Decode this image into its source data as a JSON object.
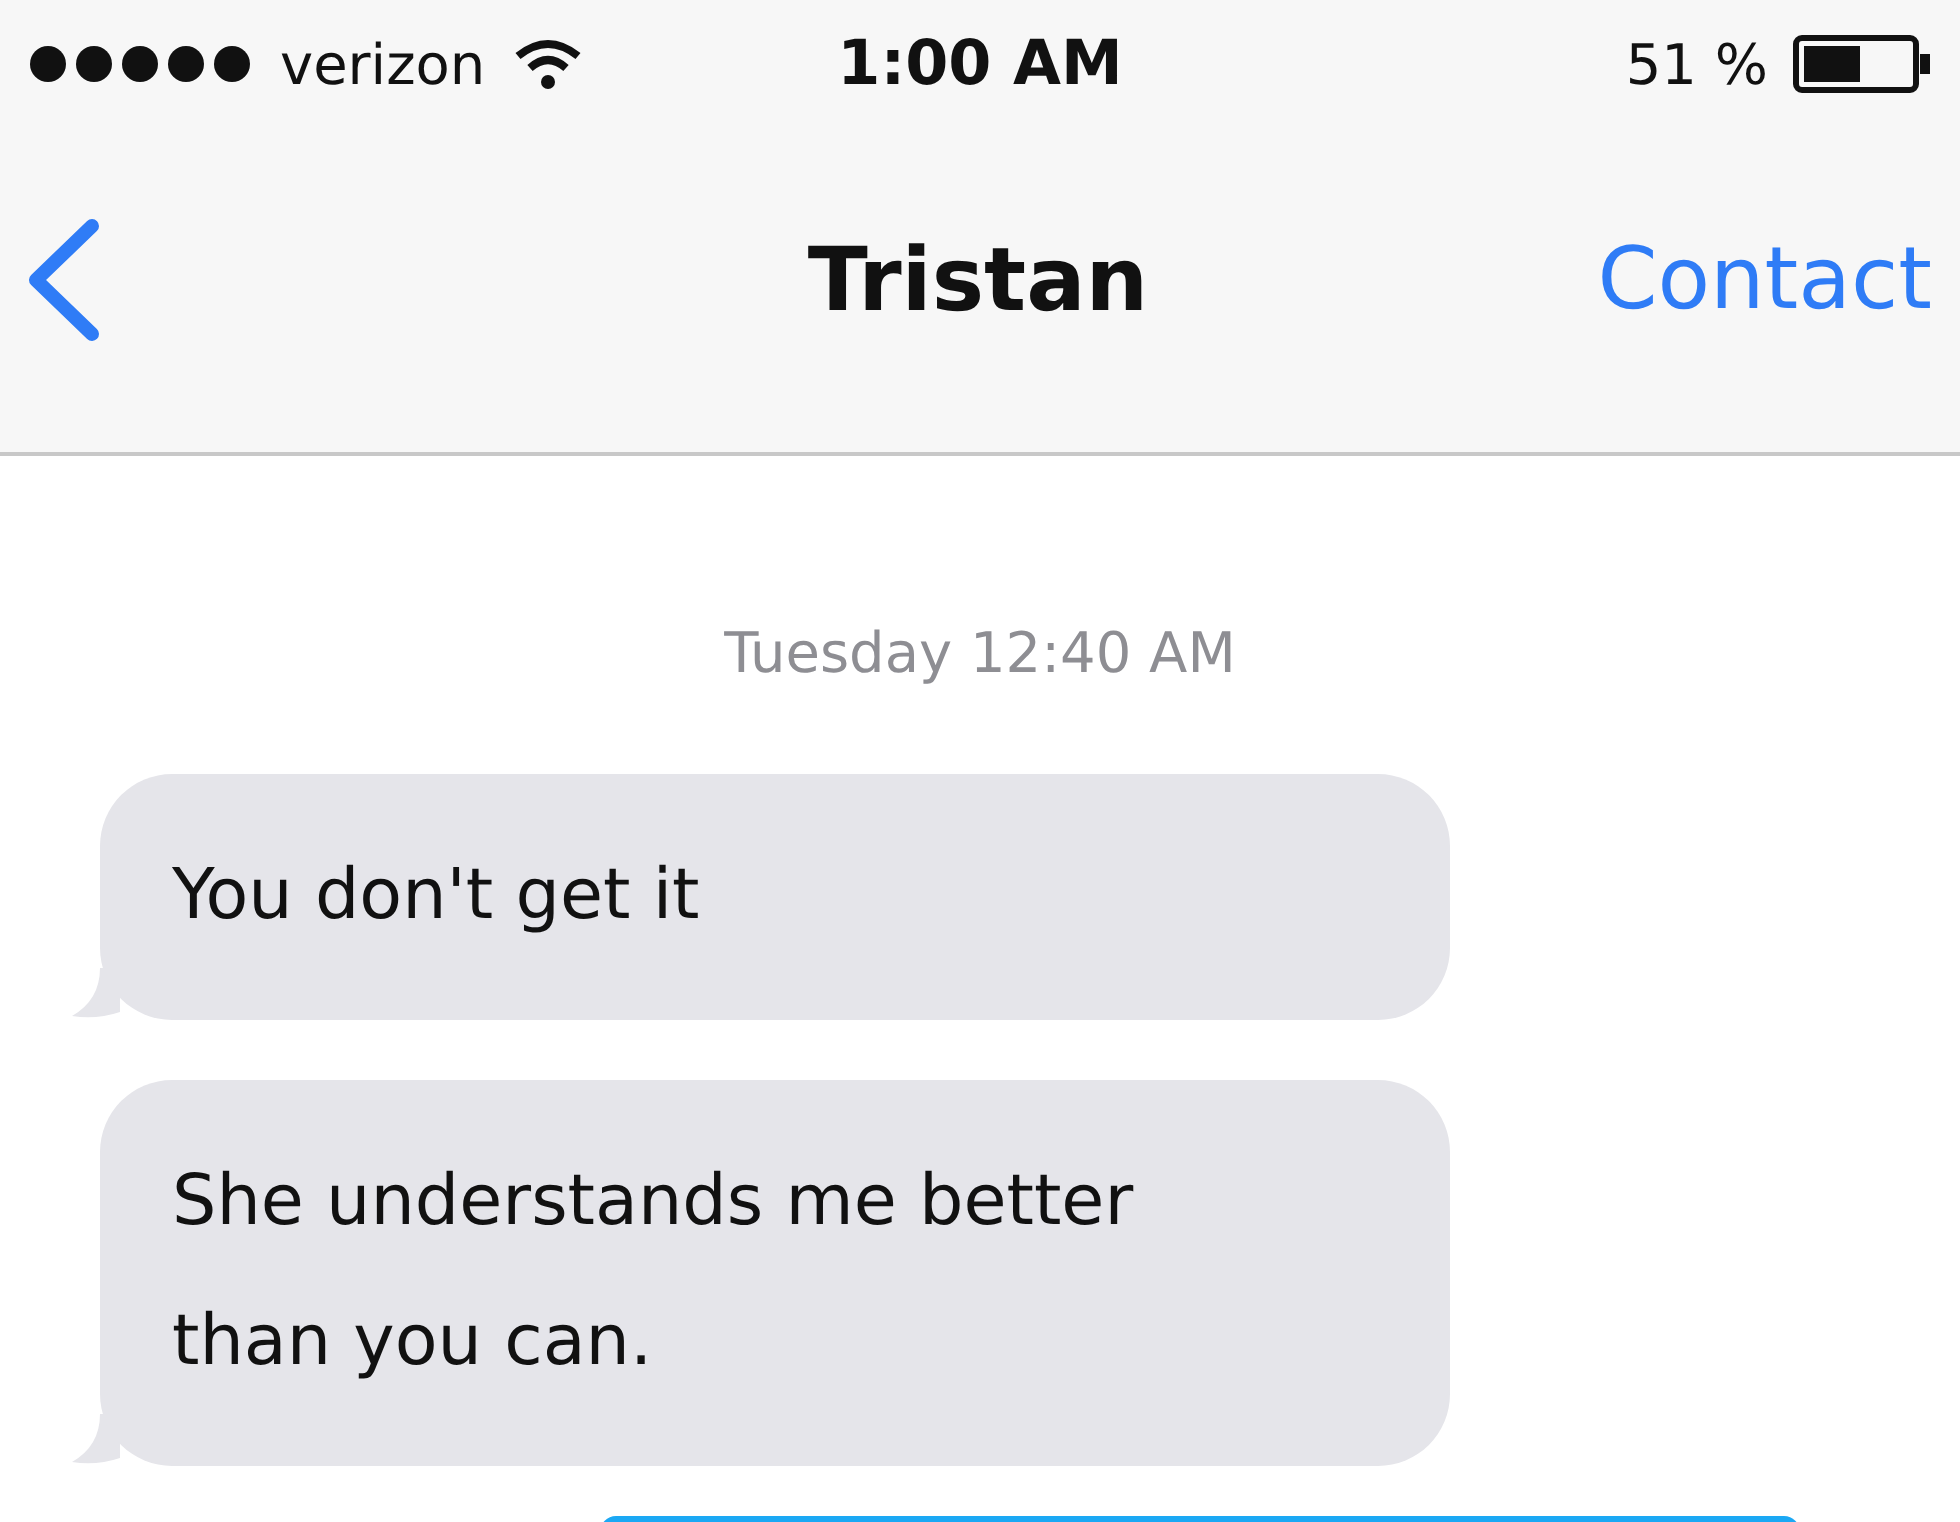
{
  "status_bar": {
    "carrier": "verizon",
    "time": "1:00 AM",
    "battery": "51 %"
  },
  "nav": {
    "title": "Tristan",
    "action": "Contact"
  },
  "messages": [
    {
      "kind": "timestamp",
      "text": "Tuesday 12:40 AM"
    },
    {
      "kind": "received",
      "text": "You don't get it"
    },
    {
      "kind": "received",
      "text": "She understands me better than you can."
    },
    {
      "kind": "sent"
    }
  ]
}
